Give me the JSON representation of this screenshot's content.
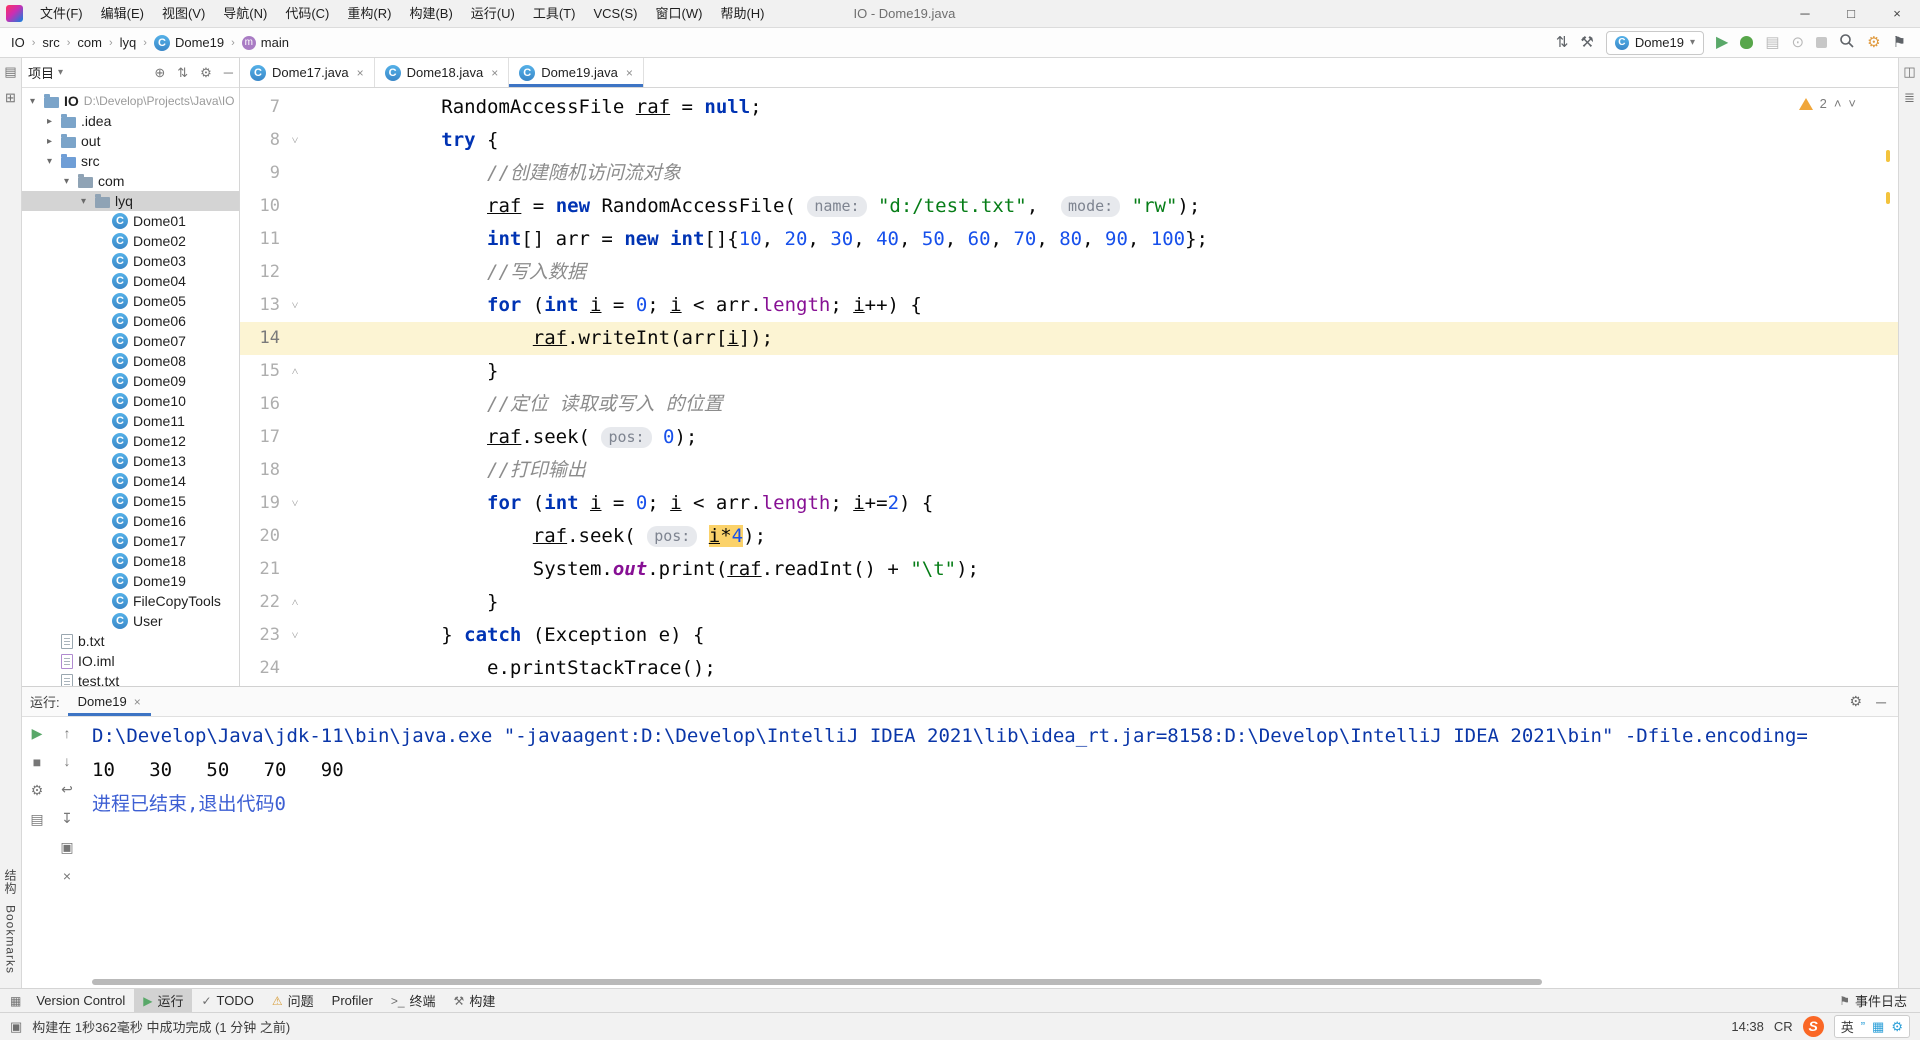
{
  "titlebar": {
    "menus": [
      "文件(F)",
      "编辑(E)",
      "视图(V)",
      "导航(N)",
      "代码(C)",
      "重构(R)",
      "构建(B)",
      "运行(U)",
      "工具(T)",
      "VCS(S)",
      "窗口(W)",
      "帮助(H)"
    ],
    "title": "IO - Dome19.java",
    "window_controls": [
      "minimize",
      "maximize",
      "close"
    ]
  },
  "navbar": {
    "breadcrumbs": [
      {
        "label": "IO",
        "icon": null
      },
      {
        "label": "src",
        "icon": null
      },
      {
        "label": "com",
        "icon": null
      },
      {
        "label": "lyq",
        "icon": null
      },
      {
        "label": "Dome19",
        "icon": "class"
      },
      {
        "label": "main",
        "icon": "method"
      }
    ],
    "run_config": "Dome19"
  },
  "left_stripe": {
    "structure_label": "结构",
    "bookmarks_label": "Bookmarks"
  },
  "project_panel": {
    "title": "项目",
    "tree": [
      {
        "depth": 0,
        "expander": "open",
        "icon": "folder",
        "label": "IO",
        "suffix": "D:\\Develop\\Projects\\Java\\IO",
        "bold": true
      },
      {
        "depth": 1,
        "expander": "closed",
        "icon": "folder",
        "label": ".idea"
      },
      {
        "depth": 1,
        "expander": "closed",
        "icon": "folder",
        "label": "out"
      },
      {
        "depth": 1,
        "expander": "open",
        "icon": "folder-src",
        "label": "src"
      },
      {
        "depth": 2,
        "expander": "open",
        "icon": "package",
        "label": "com"
      },
      {
        "depth": 3,
        "expander": "open",
        "icon": "package",
        "label": "lyq",
        "selected": true
      },
      {
        "depth": 4,
        "icon": "class",
        "label": "Dome01"
      },
      {
        "depth": 4,
        "icon": "class",
        "label": "Dome02"
      },
      {
        "depth": 4,
        "icon": "class",
        "label": "Dome03"
      },
      {
        "depth": 4,
        "icon": "class",
        "label": "Dome04"
      },
      {
        "depth": 4,
        "icon": "class",
        "label": "Dome05"
      },
      {
        "depth": 4,
        "icon": "class",
        "label": "Dome06"
      },
      {
        "depth": 4,
        "icon": "class",
        "label": "Dome07"
      },
      {
        "depth": 4,
        "icon": "class",
        "label": "Dome08"
      },
      {
        "depth": 4,
        "icon": "class",
        "label": "Dome09"
      },
      {
        "depth": 4,
        "icon": "class",
        "label": "Dome10"
      },
      {
        "depth": 4,
        "icon": "class",
        "label": "Dome11"
      },
      {
        "depth": 4,
        "icon": "class",
        "label": "Dome12"
      },
      {
        "depth": 4,
        "icon": "class",
        "label": "Dome13"
      },
      {
        "depth": 4,
        "icon": "class",
        "label": "Dome14"
      },
      {
        "depth": 4,
        "icon": "class",
        "label": "Dome15"
      },
      {
        "depth": 4,
        "icon": "class",
        "label": "Dome16"
      },
      {
        "depth": 4,
        "icon": "class",
        "label": "Dome17"
      },
      {
        "depth": 4,
        "icon": "class",
        "label": "Dome18"
      },
      {
        "depth": 4,
        "icon": "class",
        "label": "Dome19"
      },
      {
        "depth": 4,
        "icon": "class",
        "label": "FileCopyTools"
      },
      {
        "depth": 4,
        "icon": "class",
        "label": "User"
      },
      {
        "depth": 1,
        "icon": "file-text",
        "label": "b.txt"
      },
      {
        "depth": 1,
        "icon": "file-iml",
        "label": "IO.iml"
      },
      {
        "depth": 1,
        "icon": "file-text",
        "label": "test.txt"
      }
    ]
  },
  "editor": {
    "tabs": [
      {
        "label": "Dome17.java",
        "active": false
      },
      {
        "label": "Dome18.java",
        "active": false
      },
      {
        "label": "Dome19.java",
        "active": true
      }
    ],
    "inspection_warnings": "2",
    "current_line": 14,
    "lines": [
      {
        "n": 7,
        "ind": 12,
        "fold": "",
        "tok": [
          [
            "RandomAccessFile ",
            "p"
          ],
          [
            "raf",
            "v"
          ],
          [
            " = ",
            "p"
          ],
          [
            "null",
            "k"
          ],
          [
            ";",
            "p"
          ]
        ]
      },
      {
        "n": 8,
        "ind": 12,
        "fold": "v",
        "tok": [
          [
            "try",
            "k"
          ],
          [
            " {",
            "p"
          ]
        ]
      },
      {
        "n": 9,
        "ind": 16,
        "fold": "",
        "tok": [
          [
            "//创建随机访问流对象",
            "c"
          ]
        ]
      },
      {
        "n": 10,
        "ind": 16,
        "fold": "",
        "tok": [
          [
            "raf",
            "v"
          ],
          [
            " = ",
            "p"
          ],
          [
            "new",
            "k"
          ],
          [
            " RandomAccessFile( ",
            "p"
          ],
          [
            "name:",
            "h"
          ],
          [
            " ",
            "p"
          ],
          [
            "\"d:/test.txt\"",
            "s"
          ],
          [
            ",  ",
            "p"
          ],
          [
            "mode:",
            "h"
          ],
          [
            " ",
            "p"
          ],
          [
            "\"rw\"",
            "s"
          ],
          [
            ");",
            "p"
          ]
        ]
      },
      {
        "n": 11,
        "ind": 16,
        "fold": "",
        "tok": [
          [
            "int",
            "k"
          ],
          [
            "[] arr = ",
            "p"
          ],
          [
            "new",
            "k"
          ],
          [
            " ",
            "p"
          ],
          [
            "int",
            "k"
          ],
          [
            "[]{",
            "p"
          ],
          [
            "10",
            "n"
          ],
          [
            ", ",
            "p"
          ],
          [
            "20",
            "n"
          ],
          [
            ", ",
            "p"
          ],
          [
            "30",
            "n"
          ],
          [
            ", ",
            "p"
          ],
          [
            "40",
            "n"
          ],
          [
            ", ",
            "p"
          ],
          [
            "50",
            "n"
          ],
          [
            ", ",
            "p"
          ],
          [
            "60",
            "n"
          ],
          [
            ", ",
            "p"
          ],
          [
            "70",
            "n"
          ],
          [
            ", ",
            "p"
          ],
          [
            "80",
            "n"
          ],
          [
            ", ",
            "p"
          ],
          [
            "90",
            "n"
          ],
          [
            ", ",
            "p"
          ],
          [
            "100",
            "n"
          ],
          [
            "};",
            "p"
          ]
        ]
      },
      {
        "n": 12,
        "ind": 16,
        "fold": "",
        "tok": [
          [
            "//写入数据",
            "c"
          ]
        ]
      },
      {
        "n": 13,
        "ind": 16,
        "fold": "v",
        "tok": [
          [
            "for",
            "k"
          ],
          [
            " (",
            "p"
          ],
          [
            "int",
            "k"
          ],
          [
            " ",
            "p"
          ],
          [
            "i",
            "v"
          ],
          [
            " = ",
            "p"
          ],
          [
            "0",
            "n"
          ],
          [
            "; ",
            "p"
          ],
          [
            "i",
            "v"
          ],
          [
            " < arr.",
            "p"
          ],
          [
            "length",
            "f"
          ],
          [
            "; ",
            "p"
          ],
          [
            "i",
            "v"
          ],
          [
            "++) {",
            "p"
          ]
        ]
      },
      {
        "n": 14,
        "ind": 20,
        "fold": "",
        "tok": [
          [
            "raf",
            "v"
          ],
          [
            ".writeInt(arr[",
            "p"
          ],
          [
            "i",
            "v"
          ],
          [
            "]);",
            "p"
          ]
        ]
      },
      {
        "n": 15,
        "ind": 16,
        "fold": "^",
        "tok": [
          [
            "}",
            "p"
          ]
        ]
      },
      {
        "n": 16,
        "ind": 16,
        "fold": "",
        "tok": [
          [
            "//定位 读取或写入 的位置",
            "c"
          ]
        ]
      },
      {
        "n": 17,
        "ind": 16,
        "fold": "",
        "tok": [
          [
            "raf",
            "v"
          ],
          [
            ".seek( ",
            "p"
          ],
          [
            "pos:",
            "h"
          ],
          [
            " ",
            "p"
          ],
          [
            "0",
            "n"
          ],
          [
            ");",
            "p"
          ]
        ]
      },
      {
        "n": 18,
        "ind": 16,
        "fold": "",
        "tok": [
          [
            "//打印输出",
            "c"
          ]
        ]
      },
      {
        "n": 19,
        "ind": 16,
        "fold": "v",
        "tok": [
          [
            "for",
            "k"
          ],
          [
            " (",
            "p"
          ],
          [
            "int",
            "k"
          ],
          [
            " ",
            "p"
          ],
          [
            "i",
            "v"
          ],
          [
            " = ",
            "p"
          ],
          [
            "0",
            "n"
          ],
          [
            "; ",
            "p"
          ],
          [
            "i",
            "v"
          ],
          [
            " < arr.",
            "p"
          ],
          [
            "length",
            "f"
          ],
          [
            "; ",
            "p"
          ],
          [
            "i",
            "v"
          ],
          [
            "+=",
            "p"
          ],
          [
            "2",
            "n"
          ],
          [
            ") {",
            "p"
          ]
        ]
      },
      {
        "n": 20,
        "ind": 20,
        "fold": "",
        "tok": [
          [
            "raf",
            "v"
          ],
          [
            ".seek( ",
            "p"
          ],
          [
            "pos:",
            "h"
          ],
          [
            " ",
            "p"
          ],
          [
            "i",
            "v hl"
          ],
          [
            "*",
            "p hl"
          ],
          [
            "4",
            "n hl"
          ],
          [
            ");",
            "p"
          ]
        ]
      },
      {
        "n": 21,
        "ind": 20,
        "fold": "",
        "tok": [
          [
            "System.",
            "p"
          ],
          [
            "out",
            "st"
          ],
          [
            ".print(",
            "p"
          ],
          [
            "raf",
            "v"
          ],
          [
            ".readInt() + ",
            "p"
          ],
          [
            "\"\\t\"",
            "s"
          ],
          [
            ");",
            "p"
          ]
        ]
      },
      {
        "n": 22,
        "ind": 16,
        "fold": "^",
        "tok": [
          [
            "}",
            "p"
          ]
        ]
      },
      {
        "n": 23,
        "ind": 12,
        "fold": "v",
        "tok": [
          [
            "} ",
            "p"
          ],
          [
            "catch",
            "k"
          ],
          [
            " (Exception e) {",
            "p"
          ]
        ]
      },
      {
        "n": 24,
        "ind": 16,
        "fold": "",
        "tok": [
          [
            "e.printStackTrace();",
            "p"
          ]
        ]
      }
    ]
  },
  "run_panel": {
    "label": "运行:",
    "tab": "Dome19",
    "toolbar_main": [
      "rerun-icon",
      "stop-icon",
      "settings-icon",
      "layout-icon"
    ],
    "toolbar_console": [
      "up-icon",
      "down-icon",
      "softwrap-icon",
      "scroll-end-icon",
      "print-icon",
      "clear-icon"
    ],
    "console": [
      {
        "cls": "cmd",
        "text": "D:\\Develop\\Java\\jdk-11\\bin\\java.exe \"-javaagent:D:\\Develop\\IntelliJ IDEA 2021\\lib\\idea_rt.jar=8158:D:\\Develop\\IntelliJ IDEA 2021\\bin\" -Dfile.encoding="
      },
      {
        "cls": "out",
        "text": "10   30   50   70   90"
      },
      {
        "cls": "sys",
        "text": "进程已结束,退出代码0"
      }
    ]
  },
  "toolwindow_bar": {
    "items": [
      {
        "label": "Version Control",
        "icon": null,
        "active": false
      },
      {
        "label": "运行",
        "icon": "run-icon",
        "active": true
      },
      {
        "label": "TODO",
        "icon": "todo-icon",
        "active": false
      },
      {
        "label": "问题",
        "icon": "warning-icon",
        "active": false
      },
      {
        "label": "Profiler",
        "icon": null,
        "active": false
      },
      {
        "label": "终端",
        "icon": "terminal-icon",
        "active": false
      },
      {
        "label": "构建",
        "icon": "build-icon",
        "active": false
      }
    ],
    "right_label": "事件日志"
  },
  "statusbar": {
    "message": "构建在 1秒362毫秒 中成功完成 (1 分钟 之前)",
    "time": "14:38",
    "line_ending": "CR",
    "ime_badge": "S",
    "ime_lang": "英"
  }
}
